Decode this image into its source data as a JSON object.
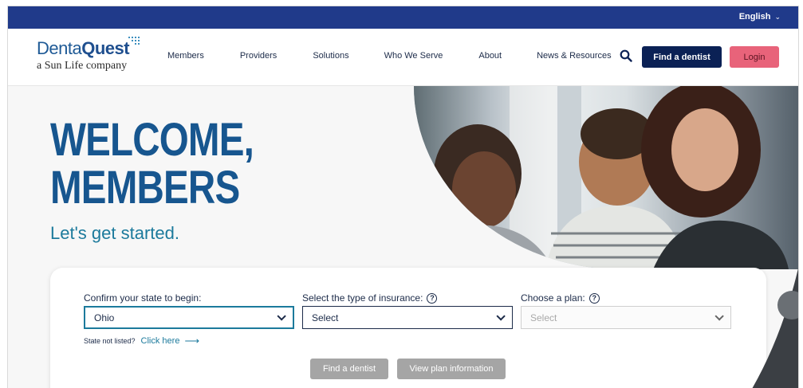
{
  "topbar": {
    "language": "English"
  },
  "logo": {
    "brand_light": "Denta",
    "brand_bold": "Quest",
    "tagline": "a Sun Life company"
  },
  "nav": {
    "items": [
      {
        "label": "Members"
      },
      {
        "label": "Providers"
      },
      {
        "label": "Solutions"
      },
      {
        "label": "Who We Serve"
      },
      {
        "label": "About"
      },
      {
        "label": "News & Resources"
      }
    ],
    "find_dentist": "Find a dentist",
    "login": "Login"
  },
  "hero": {
    "title_line1": "WELCOME,",
    "title_line2": "MEMBERS",
    "subtitle": "Let's get started."
  },
  "form": {
    "state": {
      "label": "Confirm your state to begin:",
      "value": "Ohio"
    },
    "insurance": {
      "label": "Select the type of insurance:",
      "value": "Select"
    },
    "plan": {
      "label": "Choose a plan:",
      "value": "Select"
    },
    "state_not_listed": "State not listed?",
    "click_here": "Click here",
    "find_dentist_button": "Find a dentist",
    "view_plan_button": "View plan information"
  },
  "colors": {
    "topbar": "#203a8a",
    "navy_button": "#0b2155",
    "login_button": "#e8637a",
    "hero_title": "#17568f",
    "teal": "#1c7a9c",
    "disabled_button": "#a5a5a5"
  }
}
